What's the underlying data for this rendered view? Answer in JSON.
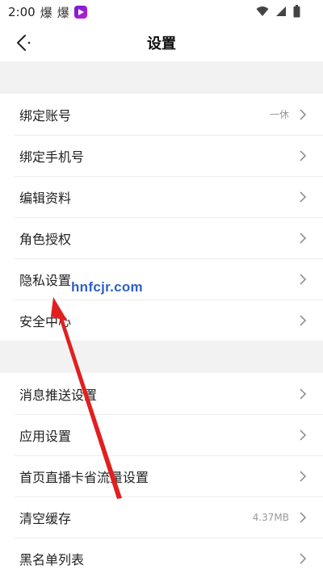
{
  "status_bar": {
    "time": "2:00",
    "app_icon_1": "爆",
    "app_icon_2": "爆"
  },
  "header": {
    "title": "设置"
  },
  "sections": [
    {
      "items": [
        {
          "label": "绑定账号",
          "value": "一休"
        },
        {
          "label": "绑定手机号",
          "value": ""
        },
        {
          "label": "编辑资料",
          "value": ""
        },
        {
          "label": "角色授权",
          "value": ""
        },
        {
          "label": "隐私设置",
          "value": ""
        },
        {
          "label": "安全中心",
          "value": ""
        }
      ]
    },
    {
      "items": [
        {
          "label": "消息推送设置",
          "value": ""
        },
        {
          "label": "应用设置",
          "value": ""
        },
        {
          "label": "首页直播卡省流量设置",
          "value": ""
        },
        {
          "label": "清空缓存",
          "value": "4.37MB"
        },
        {
          "label": "黑名单列表",
          "value": ""
        }
      ]
    }
  ],
  "overlay": {
    "watermark": "hnfcjr.com",
    "arrow_color": "#e02020"
  }
}
